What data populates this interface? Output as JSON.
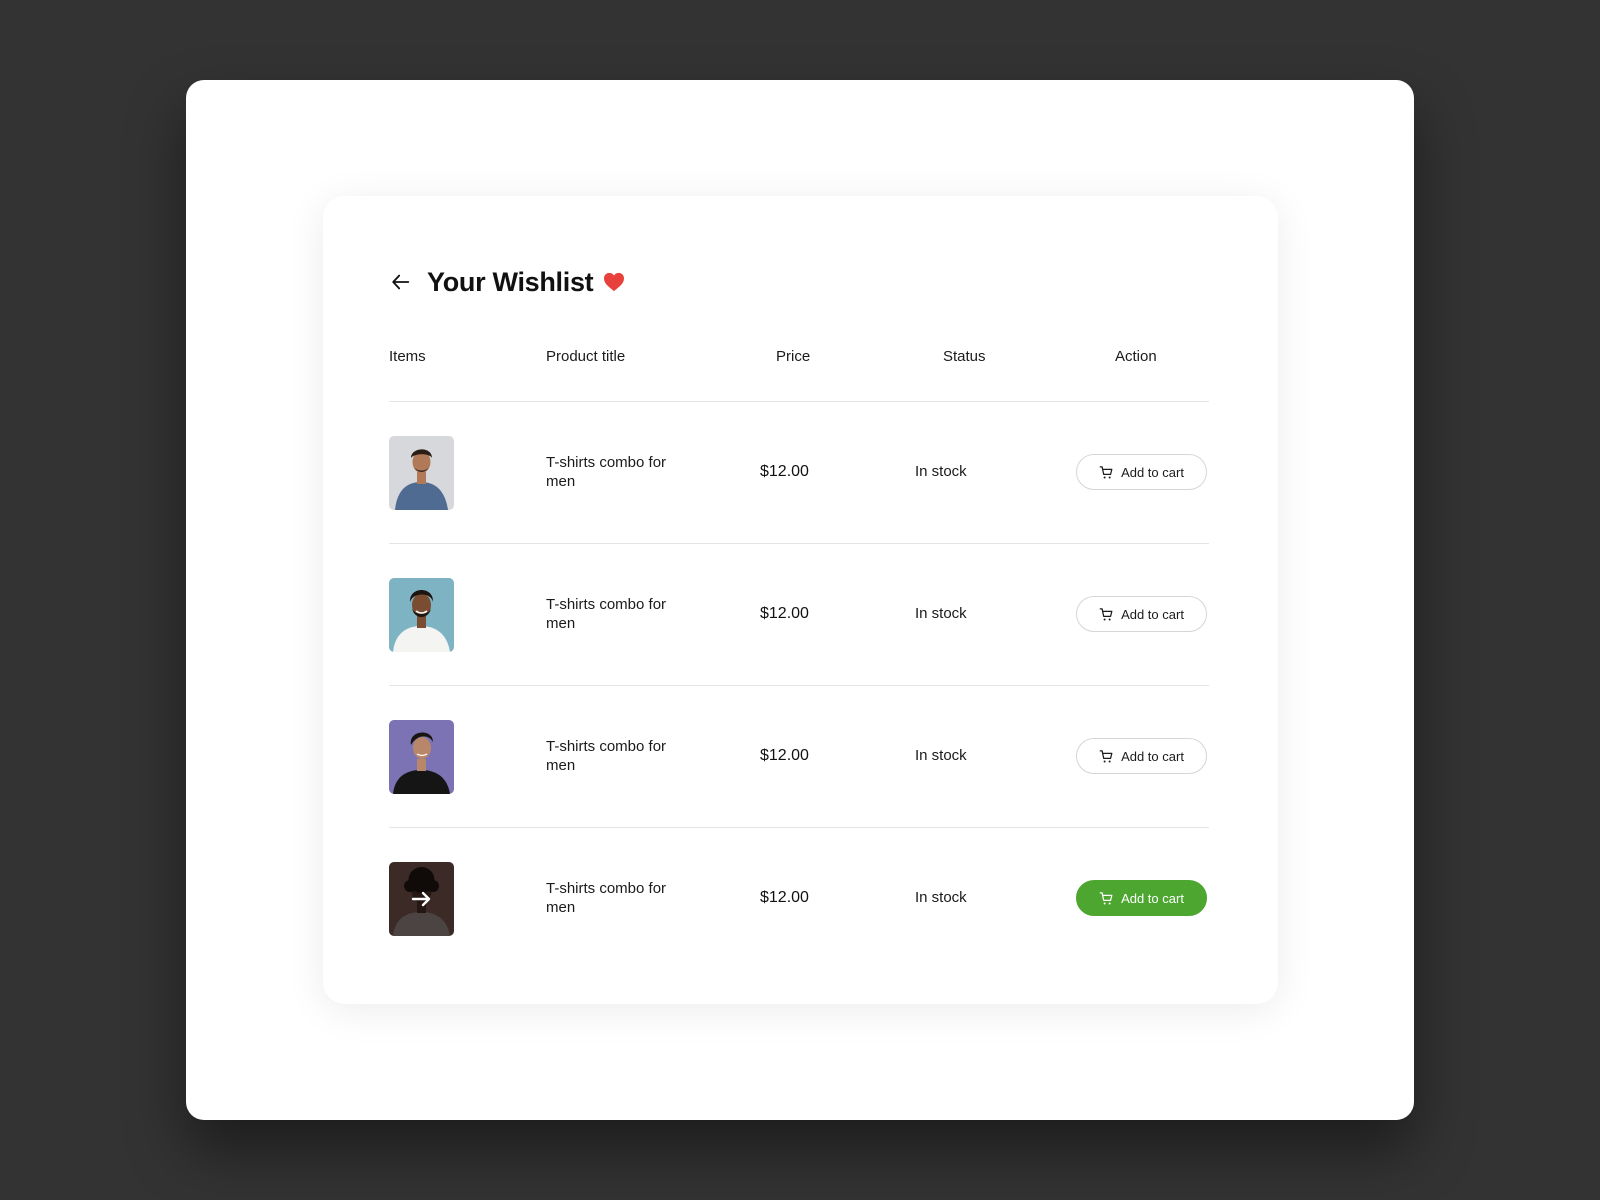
{
  "page": {
    "title": "Your Wishlist",
    "back_icon": "arrow-left-icon",
    "title_icon": "heart-icon",
    "heart_color": "#e8403a"
  },
  "columns": [
    "Items",
    "Product title",
    "Price",
    "Status",
    "Action"
  ],
  "items": [
    {
      "image": "man-blue-tshirt",
      "title": "T-shirts combo for men",
      "price": "$12.00",
      "status": "In stock",
      "action": "Add to cart",
      "active": false
    },
    {
      "image": "man-white-tshirt",
      "title": "T-shirts combo for men",
      "price": "$12.00",
      "status": "In stock",
      "action": "Add to cart",
      "active": false
    },
    {
      "image": "man-black-tshirt-purple-bg",
      "title": "T-shirts combo for men",
      "price": "$12.00",
      "status": "In stock",
      "action": "Add to cart",
      "active": false
    },
    {
      "image": "man-dark-tshirt-hover-arrow",
      "title": "T-shirts combo for men",
      "price": "$12.00",
      "status": "In stock",
      "action": "Add to cart",
      "active": true
    }
  ],
  "colors": {
    "accent_green": "#4ca630",
    "background": "#333333"
  }
}
